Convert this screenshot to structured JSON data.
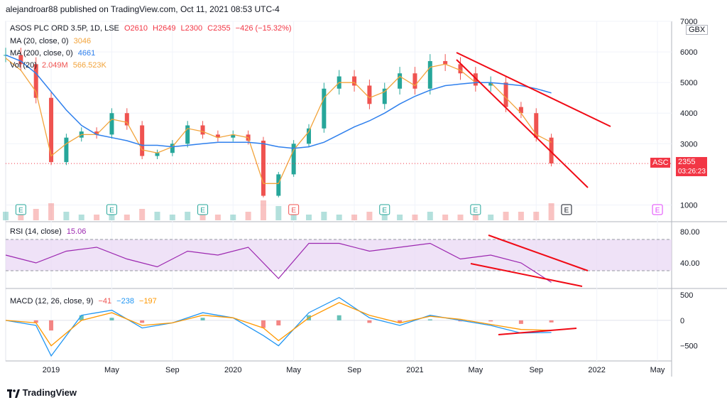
{
  "header": {
    "text": "alejandroar88 published on TradingView.com, Oct 11, 2021 08:53 UTC-4"
  },
  "footer": {
    "brand": "TradingView"
  },
  "colors": {
    "ma20": "#f2a33a",
    "ma200": "#2f80ed",
    "rsi": "#9c27b0",
    "rsi_band": "#e8d6f3",
    "macd": "#2196f3",
    "signal": "#ff9800",
    "hist_up": "#26a69a",
    "hist_down": "#ef5350",
    "trend": "#f00a15",
    "candle_up": "#26a69a",
    "candle_down": "#ef5350",
    "price_line": "#f23645"
  },
  "legend": {
    "main": {
      "symbol": "ASOS PLC ORD 3.5P, 1D, LSE",
      "o": "O2610",
      "h": "H2649",
      "l": "L2300",
      "c": "C2355",
      "chg": "−426 (−15.32%)"
    },
    "ma20": {
      "label": "MA (20, close, 0)",
      "value": "3046"
    },
    "ma200": {
      "label": "MA (200, close, 0)",
      "value": "4661"
    },
    "vol": {
      "label": "Vol (20)",
      "v1": "2.049M",
      "v2": "566.523K"
    },
    "rsi": {
      "label": "RSI (14, close)",
      "value": "15.06"
    },
    "macd": {
      "label": "MACD (12, 26, close, 9)",
      "v1": "−41",
      "v2": "−238",
      "v3": "−197"
    }
  },
  "currency": "GBX",
  "price_badge": {
    "symbol": "ASC",
    "price": "2355",
    "timer": "03:26:23"
  },
  "x_ticks": [
    "2019",
    "May",
    "Sep",
    "2020",
    "May",
    "Sep",
    "2021",
    "May",
    "Sep",
    "2022",
    "May"
  ],
  "price_ticks": [
    "7000",
    "6000",
    "5000",
    "4000",
    "3000",
    "1000"
  ],
  "rsi_ticks": [
    "80.00",
    "40.00"
  ],
  "macd_ticks": [
    "500",
    "0",
    "−500"
  ],
  "earnings_markers": [
    "E",
    "E",
    "E",
    "E",
    "E",
    "E",
    "E",
    "E"
  ],
  "chart_data": [
    {
      "type": "line",
      "title": "ASOS PLC ORD 3.5P, 1D, LSE",
      "ylabel": "",
      "ylim": [
        500,
        7000
      ],
      "x": [
        "2018-10",
        "2018-11",
        "2018-12",
        "2019-01",
        "2019-02",
        "2019-03",
        "2019-04",
        "2019-05",
        "2019-06",
        "2019-07",
        "2019-08",
        "2019-09",
        "2019-10",
        "2019-11",
        "2019-12",
        "2020-01",
        "2020-02",
        "2020-03",
        "2020-04",
        "2020-05",
        "2020-06",
        "2020-07",
        "2020-08",
        "2020-09",
        "2020-10",
        "2020-11",
        "2020-12",
        "2021-01",
        "2021-02",
        "2021-03",
        "2021-04",
        "2021-05",
        "2021-06",
        "2021-07",
        "2021-08",
        "2021-09",
        "2021-10"
      ],
      "series": [
        {
          "name": "ASOS PLC ORD 3.5P",
          "values": [
            5900,
            5600,
            4500,
            2400,
            3200,
            3400,
            3300,
            4000,
            3600,
            2600,
            2700,
            3000,
            3600,
            3300,
            3200,
            3300,
            3100,
            1300,
            2000,
            3000,
            3500,
            4800,
            5200,
            4900,
            4300,
            4800,
            5300,
            4800,
            5700,
            5600,
            5300,
            4900,
            5000,
            4200,
            4000,
            3200,
            2355
          ]
        },
        {
          "name": "MA (20, close, 0)",
          "values": [
            5800,
            5400,
            4700,
            2600,
            3000,
            3300,
            3300,
            3800,
            3700,
            2800,
            2700,
            2900,
            3500,
            3400,
            3200,
            3300,
            3200,
            1700,
            1700,
            2800,
            3400,
            4500,
            5000,
            5000,
            4500,
            4700,
            5200,
            4900,
            5500,
            5600,
            5400,
            5000,
            5000,
            4500,
            4000,
            3300,
            3046
          ]
        },
        {
          "name": "MA (200, close, 0)",
          "values": [
            5900,
            5700,
            5300,
            4700,
            4100,
            3600,
            3300,
            3200,
            3100,
            2950,
            2950,
            2900,
            2950,
            3000,
            3050,
            3050,
            3050,
            3000,
            2900,
            2850,
            2900,
            3050,
            3300,
            3550,
            3750,
            4000,
            4300,
            4550,
            4750,
            4900,
            4950,
            5000,
            5000,
            4950,
            4900,
            4800,
            4661
          ]
        }
      ]
    },
    {
      "type": "line",
      "title": "RSI (14, close)",
      "ylim": [
        10,
        90
      ],
      "x": [
        "2018-10",
        "2018-12",
        "2019-02",
        "2019-04",
        "2019-06",
        "2019-08",
        "2019-10",
        "2019-12",
        "2020-02",
        "2020-04",
        "2020-06",
        "2020-08",
        "2020-10",
        "2020-12",
        "2021-02",
        "2021-04",
        "2021-06",
        "2021-08",
        "2021-10"
      ],
      "series": [
        {
          "name": "RSI",
          "values": [
            50,
            40,
            55,
            60,
            45,
            35,
            55,
            50,
            60,
            20,
            65,
            65,
            55,
            60,
            65,
            45,
            50,
            40,
            15.06
          ]
        }
      ]
    },
    {
      "type": "line",
      "title": "MACD (12, 26, close, 9)",
      "ylim": [
        -800,
        600
      ],
      "x": [
        "2018-10",
        "2018-12",
        "2019-01",
        "2019-03",
        "2019-05",
        "2019-07",
        "2019-09",
        "2019-11",
        "2020-01",
        "2020-03",
        "2020-04",
        "2020-06",
        "2020-08",
        "2020-10",
        "2020-12",
        "2021-02",
        "2021-04",
        "2021-06",
        "2021-08",
        "2021-10"
      ],
      "series": [
        {
          "name": "MACD",
          "values": [
            0,
            -100,
            -700,
            100,
            200,
            -150,
            -50,
            150,
            50,
            -300,
            -500,
            150,
            450,
            50,
            -100,
            100,
            0,
            -100,
            -250,
            -238
          ]
        },
        {
          "name": "Signal",
          "values": [
            0,
            -50,
            -500,
            0,
            150,
            -100,
            -50,
            100,
            50,
            -150,
            -400,
            50,
            350,
            100,
            -50,
            80,
            20,
            -80,
            -180,
            -197
          ]
        }
      ]
    }
  ]
}
